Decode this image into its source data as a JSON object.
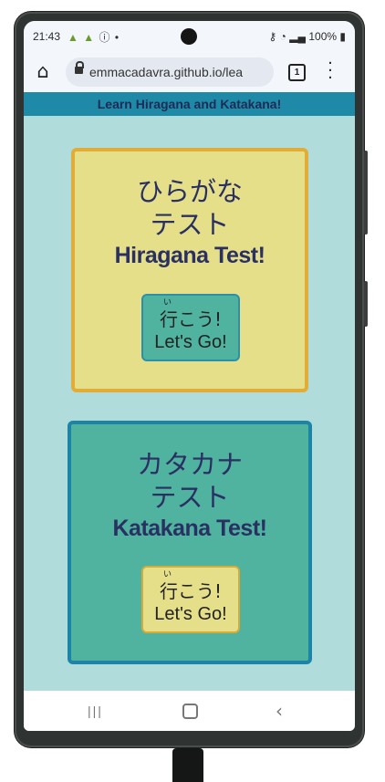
{
  "status_bar": {
    "time": "21:43",
    "left_icons": "android-icon android-icon info-icon dot",
    "battery": "100%"
  },
  "browser": {
    "url": "emmacadavra.github.io/lea",
    "tab_count": "1"
  },
  "site_header": {
    "title": "Learn Hiragana and Katakana!",
    "color": "#1f8aa8"
  },
  "cards": [
    {
      "title_jp_line1": "ひらがな",
      "title_jp_line2": "テスト",
      "title_en": "Hiragana Test!",
      "button_furigana": "い",
      "button_jp": "行こう!",
      "button_en": "Let's Go!",
      "bg_color": "#e5df8a",
      "border_color": "#e2ad37"
    },
    {
      "title_jp_line1": "カタカナ",
      "title_jp_line2": "テスト",
      "title_en": "Katakana Test!",
      "button_furigana": "い",
      "button_jp": "行こう!",
      "button_en": "Let's Go!",
      "bg_color": "#4fb39f",
      "border_color": "#1e84a6"
    }
  ],
  "nav_bar": {
    "icons": [
      "recents-icon",
      "home-icon",
      "back-icon"
    ]
  }
}
